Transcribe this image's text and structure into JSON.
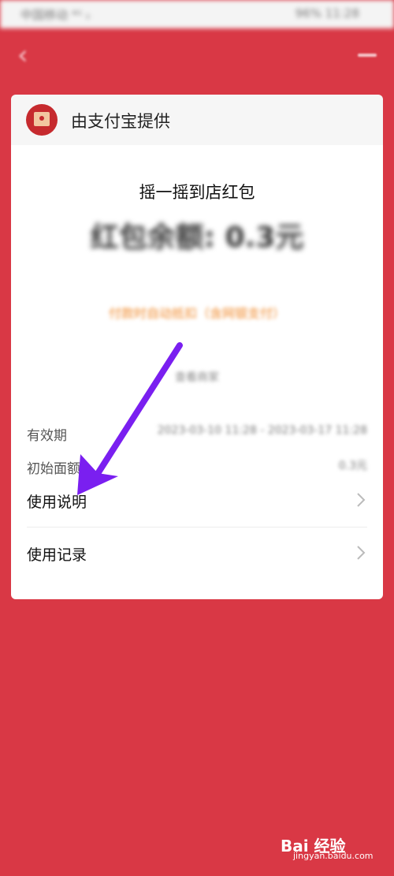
{
  "status_bar": {
    "left": "中国移动 ⁴ᴳ ᵢᵢ",
    "right": "96% 11:28"
  },
  "provider": {
    "text": "由支付宝提供"
  },
  "card": {
    "title": "摇一摇到店红包",
    "balance": "红包余额: 0.3元",
    "note": "付款时自动抵扣（含网银支付）",
    "sublink": "查看商家",
    "validity_label": "有效期",
    "validity_value": "2023-03-10 11:28 - 2023-03-17 11:28",
    "initial_label": "初始面额",
    "initial_value": "0.3元",
    "menu": [
      {
        "label": "使用说明"
      },
      {
        "label": "使用记录"
      }
    ]
  },
  "watermark": {
    "main": "Bai 经验",
    "sub": "jingyan.baidu.com"
  },
  "colors": {
    "background": "#d93845",
    "arrow": "#7a1ff0",
    "note": "#f08a2c"
  }
}
